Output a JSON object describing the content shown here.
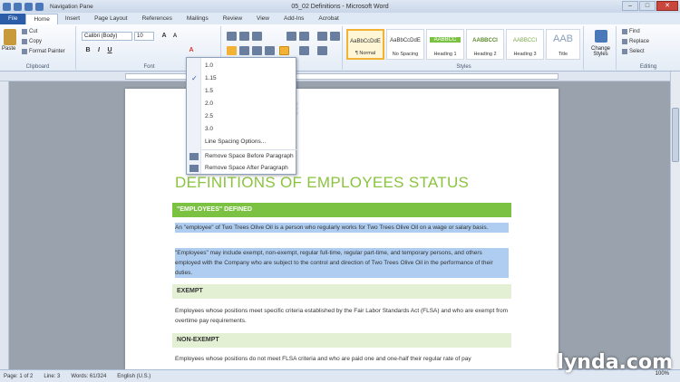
{
  "window": {
    "title": "05_02 Definitions - Microsoft Word",
    "qat_extra": "Navigation Pane"
  },
  "tabs": [
    "File",
    "Home",
    "Insert",
    "Page Layout",
    "References",
    "Mailings",
    "Review",
    "View",
    "Add-Ins",
    "Acrobat"
  ],
  "clipboard": {
    "paste": "Paste",
    "cut": "Cut",
    "copy": "Copy",
    "painter": "Format Painter",
    "label": "Clipboard"
  },
  "font": {
    "name": "Calibri (Body)",
    "size": "10",
    "label": "Font"
  },
  "paragraph": {
    "label": "Paragraph"
  },
  "styles": {
    "label": "Styles",
    "items": [
      {
        "sample": "AaBbCcDdE",
        "name": "¶ Normal"
      },
      {
        "sample": "AaBbCcDdE",
        "name": "No Spacing"
      },
      {
        "sample": "AABBCC",
        "name": "Heading 1"
      },
      {
        "sample": "AABBCCI",
        "name": "Heading 2"
      },
      {
        "sample": "AABBCCI",
        "name": "Heading 3"
      },
      {
        "sample": "AAB",
        "name": "Title"
      }
    ],
    "change": "Change Styles"
  },
  "editing": {
    "find": "Find",
    "replace": "Replace",
    "select": "Select",
    "label": "Editing"
  },
  "line_spacing_menu": {
    "options": [
      "1.0",
      "1.15",
      "1.5",
      "2.0",
      "2.5",
      "3.0"
    ],
    "checked": "1.15",
    "more": "Line Spacing Options...",
    "remove_before": "Remove Space Before Paragraph",
    "remove_after": "Remove Space After Paragraph"
  },
  "document": {
    "title": "DEFINITIONS OF EMPLOYEES STATUS",
    "h1": "\"EMPLOYEES\" DEFINED",
    "p1": "An \"employee\" of Two Trees Olive Oil is a person who regularly works for Two Trees Olive Oil on a wage or salary basis.",
    "p2": "\"Employees\" may include exempt, non-exempt, regular full-time, regular part-time, and temporary persons, and others employed with the Company who are subject to the control and direction of Two Trees Olive Oil in the performance of their duties.",
    "h2a": "EXEMPT",
    "p3": "Employees whose positions meet specific criteria established by the Fair Labor Standards Act (FLSA) and who are exempt from overtime pay requirements.",
    "h2b": "NON-EXEMPT",
    "p4": "Employees whose positions do not meet FLSA criteria and who are paid one and one-half their regular rate of pay"
  },
  "status": {
    "page": "Page: 1 of 2",
    "line": "Line: 3",
    "words": "Words: 61/324",
    "lang": "English (U.S.)",
    "zoom": "100%"
  },
  "watermark": "lynda.com"
}
